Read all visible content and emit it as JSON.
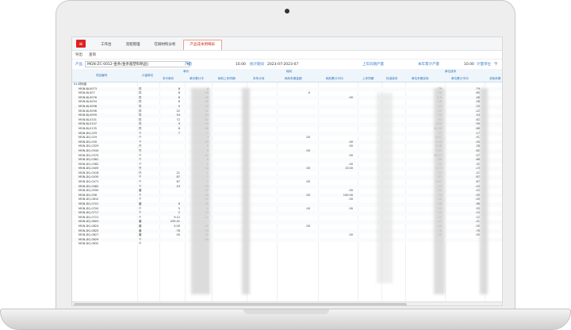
{
  "tabs": [
    {
      "label": "工作台",
      "active": false
    },
    {
      "label": "流程管理",
      "active": false
    },
    {
      "label": "在研材料分析",
      "active": false
    },
    {
      "label": "产品成本明细表",
      "active": true
    }
  ],
  "toolbar": {
    "export_label": "导出",
    "query_label": "查询"
  },
  "filter": {
    "product_label": "产品",
    "product_value": "MGN-ZC-0012-金条(金条箍塑料制品)",
    "output_label": "产量",
    "output_value": "10.00",
    "period_label": "统计期间",
    "period_value": "2023-07-2023-07",
    "prev_output_label": "上年同期产量",
    "prev_output_value": "",
    "cum_output_label": "本年累计产量",
    "cum_output_value": "10.00",
    "unit_label": "计量单位",
    "unit_value": "个"
  },
  "headers": {
    "material_code": "项目编号",
    "unit": "计量单位",
    "group_unit_price": "单价",
    "this_month_unit_price": "本行单价",
    "cum_unit_price": "单价累计平",
    "group_material": "耗料",
    "prev_material": "耗料上年同期",
    "this_month_plan": "本年计划",
    "material_amount": "耗料本期金额",
    "material_cum": "耗料累计平均",
    "group_unit_cost": "单位成本",
    "prev_unit_cost": "上年同期",
    "plan_cost": "标准成本",
    "unit_cost_this": "单位本期实际",
    "unit_cost_cum": "单位累计平均",
    "last_col": "总耗本期"
  },
  "tree_root": "01-材料费",
  "rows": [
    {
      "name": "MGN-BJ-0073",
      "unit": "件",
      "a": "8",
      "b": "4",
      "c": "",
      "d": "",
      "e": "",
      "f": ".79",
      "g": ".79"
    },
    {
      "name": "MGN-BJ-007",
      "unit": "件",
      "a": "8",
      "b": ".48",
      "c": "",
      "d": ".0",
      "e": "",
      "f": ".50",
      "g": ".60"
    },
    {
      "name": "MGN-BJ-0076",
      "unit": "件",
      "a": "8",
      "b": ".48",
      "c": "",
      "d": "",
      "e": ".00",
      "f": "4.8",
      "g": ".48"
    },
    {
      "name": "MGN-BJ-0094",
      "unit": "件",
      "a": "8",
      "b": ".08",
      "c": "",
      "d": "",
      "e": "",
      "f": ".08",
      "g": ".08"
    },
    {
      "name": "MGN-BJ-0098",
      "unit": "件",
      "a": "0",
      "b": ".20",
      "c": "",
      "d": "",
      "e": "",
      "f": ".20",
      "g": ".20"
    },
    {
      "name": "MGN-BJ-0096",
      "unit": "件",
      "a": "22",
      "b": "22",
      "c": "",
      "d": "",
      "e": "",
      "f": ".22",
      "g": ".22"
    },
    {
      "name": "MGN-BJ-0099",
      "unit": "件",
      "a": "54",
      "b": ".54",
      "c": "",
      "d": "",
      "e": "",
      "f": ".54",
      "g": ".54"
    },
    {
      "name": "MGN-BJ-0101",
      "unit": "件",
      "a": "72",
      "b": ".62",
      "c": "",
      "d": "",
      "e": "",
      "f": ".62",
      "g": ".62"
    },
    {
      "name": "MGN-BJ-0107",
      "unit": "件",
      "a": "9",
      "b": ".99",
      "c": "",
      "d": "",
      "e": "",
      "f": "4.99",
      "g": ".99"
    },
    {
      "name": "MGN-BJ-0135",
      "unit": "件",
      "a": "6",
      "b": ".86",
      "c": "",
      "d": "",
      "e": "",
      "f": "11.86",
      "g": ".86"
    },
    {
      "name": "MGN-DQ-029",
      "unit": "个",
      "a": "7",
      "b": ".7",
      "c": "",
      "d": "",
      "e": "",
      "f": ".17",
      "g": ".17"
    },
    {
      "name": "MGN-DQ-029",
      "unit": "个",
      "a": "",
      "b": "4",
      "c": "",
      "d": ".00",
      "e": "",
      "f": "0.51",
      "g": ".51"
    },
    {
      "name": "MGN-DQ-030",
      "unit": "个",
      "a": "",
      "b": ".00",
      "c": "",
      "d": "",
      "e": ".00",
      "f": "4.00",
      "g": ".00"
    },
    {
      "name": "MGN-DQ-0329",
      "unit": "只",
      "a": "",
      "b": "6",
      "c": "",
      "d": "",
      "e": ".00",
      "f": "1.28",
      "g": ".28"
    },
    {
      "name": "MGN-DQ-0344",
      "unit": "只",
      "a": "",
      "b": "6",
      "c": "",
      "d": ".00",
      "e": "",
      "f": "1.82",
      "g": ".82"
    },
    {
      "name": "MGN-DQ-0370",
      "unit": "个",
      "a": "",
      "b": ".00",
      "c": "",
      "d": "",
      "e": ".00",
      "f": "15.07",
      "g": ".07"
    },
    {
      "name": "MGN-DQ-0381",
      "unit": "个",
      "a": "",
      "b": "6",
      "c": "",
      "d": "",
      "e": "",
      "f": ".66",
      "g": ".66"
    },
    {
      "name": "MGN-DQ-0382",
      "unit": "个",
      "a": "",
      "b": "2",
      "c": "",
      "d": "",
      "e": ".00",
      "f": ".32",
      "g": ".32"
    },
    {
      "name": "MGN-DQ-0405",
      "unit": "只",
      "a": "",
      "b": ".12",
      "c": "",
      "d": ".00",
      "e": "13.00",
      "f": "1.13",
      "g": ".13"
    },
    {
      "name": "MGN-DQ-0416",
      "unit": "只",
      "a": "21",
      "b": ".1",
      "c": "",
      "d": "",
      "e": "",
      "f": ".21",
      "g": ".21"
    },
    {
      "name": "MGN-DQ-0430",
      "unit": "个",
      "a": "87",
      "b": ".7",
      "c": "",
      "d": "",
      "e": "",
      "f": ".87",
      "g": ".87"
    },
    {
      "name": "MGN-DQ-0471",
      "unit": "个",
      "a": "67",
      "b": ".7",
      "c": "",
      "d": ".00",
      "e": "",
      "f": "4.67",
      "g": ".67"
    },
    {
      "name": "MGN-DQ-0482",
      "unit": "个",
      "a": "43",
      "b": ".43",
      "c": "",
      "d": "",
      "e": "",
      "f": ".43",
      "g": ".43"
    },
    {
      "name": "MGN-DQ-0550",
      "unit": "套",
      "a": "",
      "b": ".02",
      "c": "",
      "d": "",
      "e": ".00",
      "f": ".02",
      "g": ".02"
    },
    {
      "name": "MGN-DQ-056",
      "unit": "个",
      "a": "",
      "b": ".05",
      "c": "",
      "d": ".00",
      "e": "100.00",
      "f": ".05",
      "g": ".05"
    },
    {
      "name": "MGN-DQ-0610",
      "unit": "个",
      "a": "",
      "b": ".00",
      "c": "",
      "d": "",
      "e": ".00",
      "f": ".00",
      "g": ".00"
    },
    {
      "name": "MGN-DQ-0701",
      "unit": "套",
      "a": "6",
      "b": ".96",
      "c": "",
      "d": "",
      "e": "",
      "f": ".96",
      "g": ".96"
    },
    {
      "name": "MGN-DQ-0700",
      "unit": "个",
      "a": "5",
      "b": ".5",
      "c": "",
      "d": ".00",
      "e": ".00",
      "f": ".55",
      "g": ".55"
    },
    {
      "name": "MGN-DQ-0717",
      "unit": "个",
      "a": "2",
      "b": ".10",
      "c": "",
      "d": "",
      "e": "",
      "f": ".10",
      "g": ".10"
    },
    {
      "name": "MGN-DQ-0721",
      "unit": "个",
      "a": "9.12",
      "b": ".12",
      "c": "",
      "d": "",
      "e": "",
      "f": ".12",
      "g": ".12"
    },
    {
      "name": "MGN-DQ-0803",
      "unit": "套",
      "a": "255.41",
      "b": "",
      "c": "",
      "d": "",
      "e": "",
      "f": ".41",
      "g": ".41"
    },
    {
      "name": "MGN-DQ-0824",
      "unit": "套",
      "a": "0.00",
      "b": ".00",
      "c": "",
      "d": ".00",
      "e": "",
      "f": ".00",
      "g": ".00"
    },
    {
      "name": "MGN-DQ-0825",
      "unit": "套",
      "a": ".76",
      "b": ".76",
      "c": "",
      "d": "",
      "e": "",
      "f": ".76",
      "g": ".76"
    },
    {
      "name": "MGN-DQ-0827",
      "unit": "套",
      "a": "00",
      "b": ".00",
      "c": "",
      "d": "",
      "e": ".00",
      "f": ".00",
      "g": ".00"
    },
    {
      "name": "MGN-DQ-0829",
      "unit": "个",
      "a": "",
      "b": ".00",
      "c": "",
      "d": "",
      "e": "",
      "f": "",
      "g": ""
    },
    {
      "name": "MGN-DQ-0832",
      "unit": "个",
      "a": "",
      "b": "",
      "c": "",
      "d": "",
      "e": "",
      "f": "",
      "g": ""
    }
  ]
}
